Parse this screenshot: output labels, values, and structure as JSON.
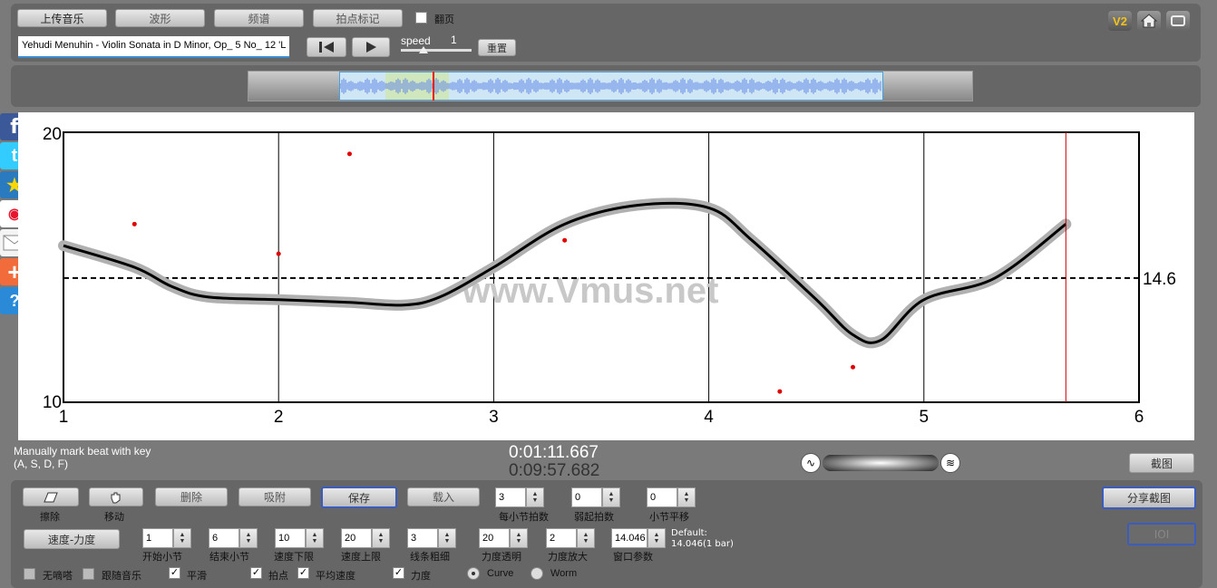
{
  "top_toolbar": {
    "upload_label": "上传音乐",
    "waveform_label": "波形",
    "spectrum_label": "频谱",
    "beat_mark_label": "拍点标记",
    "page_turn_label": "翻页",
    "file_name": "Yehudi Menuhin - Violin Sonata in D Minor, Op_ 5 No_ 12 'L",
    "speed_label": "speed",
    "speed_value": "1",
    "reset_label": "重置",
    "version_badge": "V2"
  },
  "overview": {
    "selection_fraction_start": 0.083,
    "selection_fraction_end": 0.2,
    "playhead_fraction": 0.17
  },
  "chart_data": {
    "type": "line",
    "title": "",
    "xlim": [
      1,
      6
    ],
    "ylim": [
      10,
      20
    ],
    "x_ticks": [
      "1",
      "2",
      "3",
      "4",
      "5",
      "6"
    ],
    "y_ticks": [
      "10",
      "20"
    ],
    "average_line": {
      "value": 14.6,
      "label": "14.6"
    },
    "cursor_x": 5.66,
    "curve": {
      "x": [
        1.0,
        1.33,
        1.5,
        1.67,
        2.0,
        2.33,
        2.58,
        2.75,
        3.0,
        3.33,
        3.67,
        4.0,
        4.2,
        4.5,
        4.67,
        4.8,
        5.0,
        5.33,
        5.66
      ],
      "y": [
        15.8,
        15.0,
        14.3,
        13.9,
        13.8,
        13.7,
        13.6,
        13.9,
        15.0,
        16.6,
        17.3,
        17.2,
        16.0,
        13.8,
        12.5,
        12.3,
        13.8,
        14.6,
        16.6
      ]
    },
    "points": {
      "x": [
        1.33,
        2.0,
        2.33,
        3.33,
        4.33,
        4.67
      ],
      "y": [
        16.6,
        15.5,
        19.2,
        16.0,
        10.4,
        11.3
      ]
    }
  },
  "watermark": "www.Vmus.net",
  "status": {
    "hint_line1": "Manually mark beat with key",
    "hint_line2": "(A, S, D, F)",
    "current_time": "0:01:11.667",
    "total_time": "0:09:57.682",
    "screenshot_label": "截图"
  },
  "controls": {
    "erase_label": "擦除",
    "move_label": "移动",
    "delete_label": "删除",
    "snap_label": "吸附",
    "save_label": "保存",
    "load_label": "载入",
    "beats_per_bar": {
      "value": "3",
      "label": "每小节拍数"
    },
    "pickup_beats": {
      "value": "0",
      "label": "弱起拍数"
    },
    "bar_shift": {
      "value": "0",
      "label": "小节平移"
    },
    "share_label": "分享截图",
    "ioi_label": "IOI",
    "mode_label": "速度-力度",
    "start_bar": {
      "value": "1",
      "label": "开始小节"
    },
    "end_bar": {
      "value": "6",
      "label": "结束小节"
    },
    "tempo_min": {
      "value": "10",
      "label": "速度下限"
    },
    "tempo_max": {
      "value": "20",
      "label": "速度上限"
    },
    "line_width": {
      "value": "3",
      "label": "线条粗细"
    },
    "dyn_transparency": {
      "value": "20",
      "label": "力度透明"
    },
    "dyn_zoom": {
      "value": "2",
      "label": "力度放大"
    },
    "window_param": {
      "value": "14.046",
      "label": "窗口参数"
    },
    "default_line1": "Default:",
    "default_line2": "14.046(1 bar)",
    "no_click_label": "无嘀嗒",
    "follow_music_label": "跟随音乐",
    "smooth_label": "平滑",
    "beat_points_label": "拍点",
    "avg_tempo_label": "平均速度",
    "dynamics_label": "力度",
    "curve_label": "Curve",
    "worm_label": "Worm"
  },
  "colors": {
    "curve": "#000000",
    "curve_halo": "#b0b0b0",
    "points": "#e00000",
    "cursor": "#cc0000",
    "selection": "#cfe7b8",
    "waveform": "#5f86e6"
  }
}
